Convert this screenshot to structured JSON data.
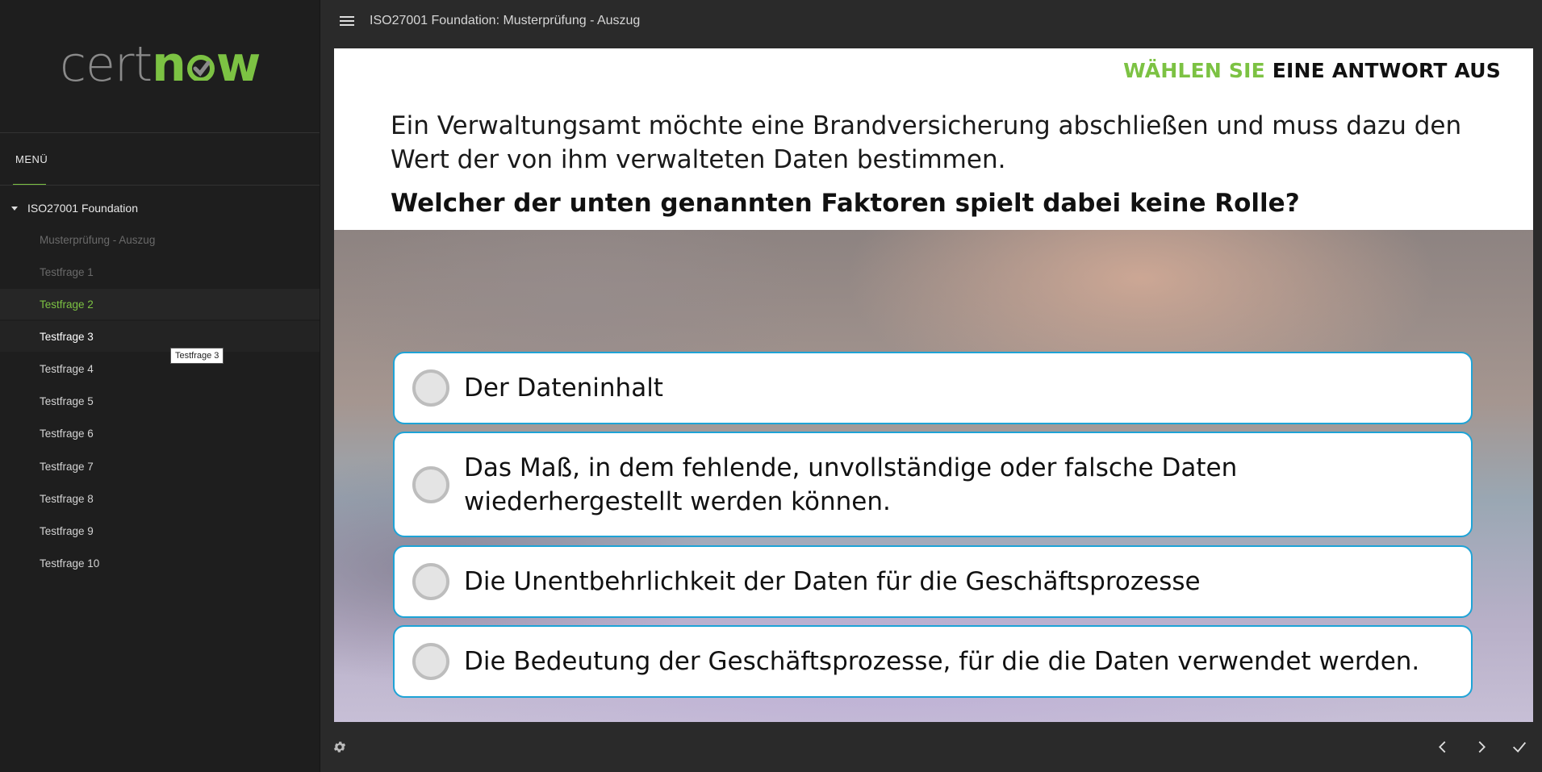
{
  "brand": {
    "logo_part1": "cert",
    "logo_part2": "n",
    "logo_part3": "w",
    "accent_color": "#7cc243"
  },
  "sidebar": {
    "menu_label": "MENÜ",
    "course": "ISO27001 Foundation",
    "items": [
      {
        "label": "Musterprüfung - Auszug",
        "state": "disabled"
      },
      {
        "label": "Testfrage 1",
        "state": "disabled"
      },
      {
        "label": "Testfrage 2",
        "state": "active"
      },
      {
        "label": "Testfrage 3",
        "state": "hover"
      },
      {
        "label": "Testfrage 4",
        "state": "normal"
      },
      {
        "label": "Testfrage 5",
        "state": "normal"
      },
      {
        "label": "Testfrage 6",
        "state": "normal"
      },
      {
        "label": "Testfrage 7",
        "state": "normal"
      },
      {
        "label": "Testfrage 8",
        "state": "normal"
      },
      {
        "label": "Testfrage 9",
        "state": "normal"
      },
      {
        "label": "Testfrage 10",
        "state": "normal"
      }
    ],
    "tooltip": "Testfrage 3"
  },
  "header": {
    "title": "ISO27001 Foundation: Musterprüfung - Auszug",
    "menu_icon": "hamburger-icon"
  },
  "quiz": {
    "instruction_highlight": "WÄHLEN SIE",
    "instruction_rest": "EINE ANTWORT AUS",
    "question": "Ein Verwaltungsamt möchte eine Brandversicherung abschließen und muss dazu den Wert der von ihm verwalteten Daten bestimmen.",
    "question_bold": "Welcher der unten genannten Faktoren spielt dabei keine Rolle?",
    "options": [
      "Der Dateninhalt",
      "Das Maß, in dem fehlende, unvollständige oder falsche Daten wiederhergestellt werden können.",
      "Die Unentbehrlichkeit der Daten für die Geschäftsprozesse",
      "Die Bedeutung der Geschäftsprozesse, für die die Daten verwendet werden."
    ],
    "option_border_color": "#1ea3d6"
  },
  "footer": {
    "settings_icon": "gear-icon",
    "prev_icon": "chevron-left-icon",
    "next_icon": "chevron-right-icon",
    "submit_icon": "check-icon"
  }
}
